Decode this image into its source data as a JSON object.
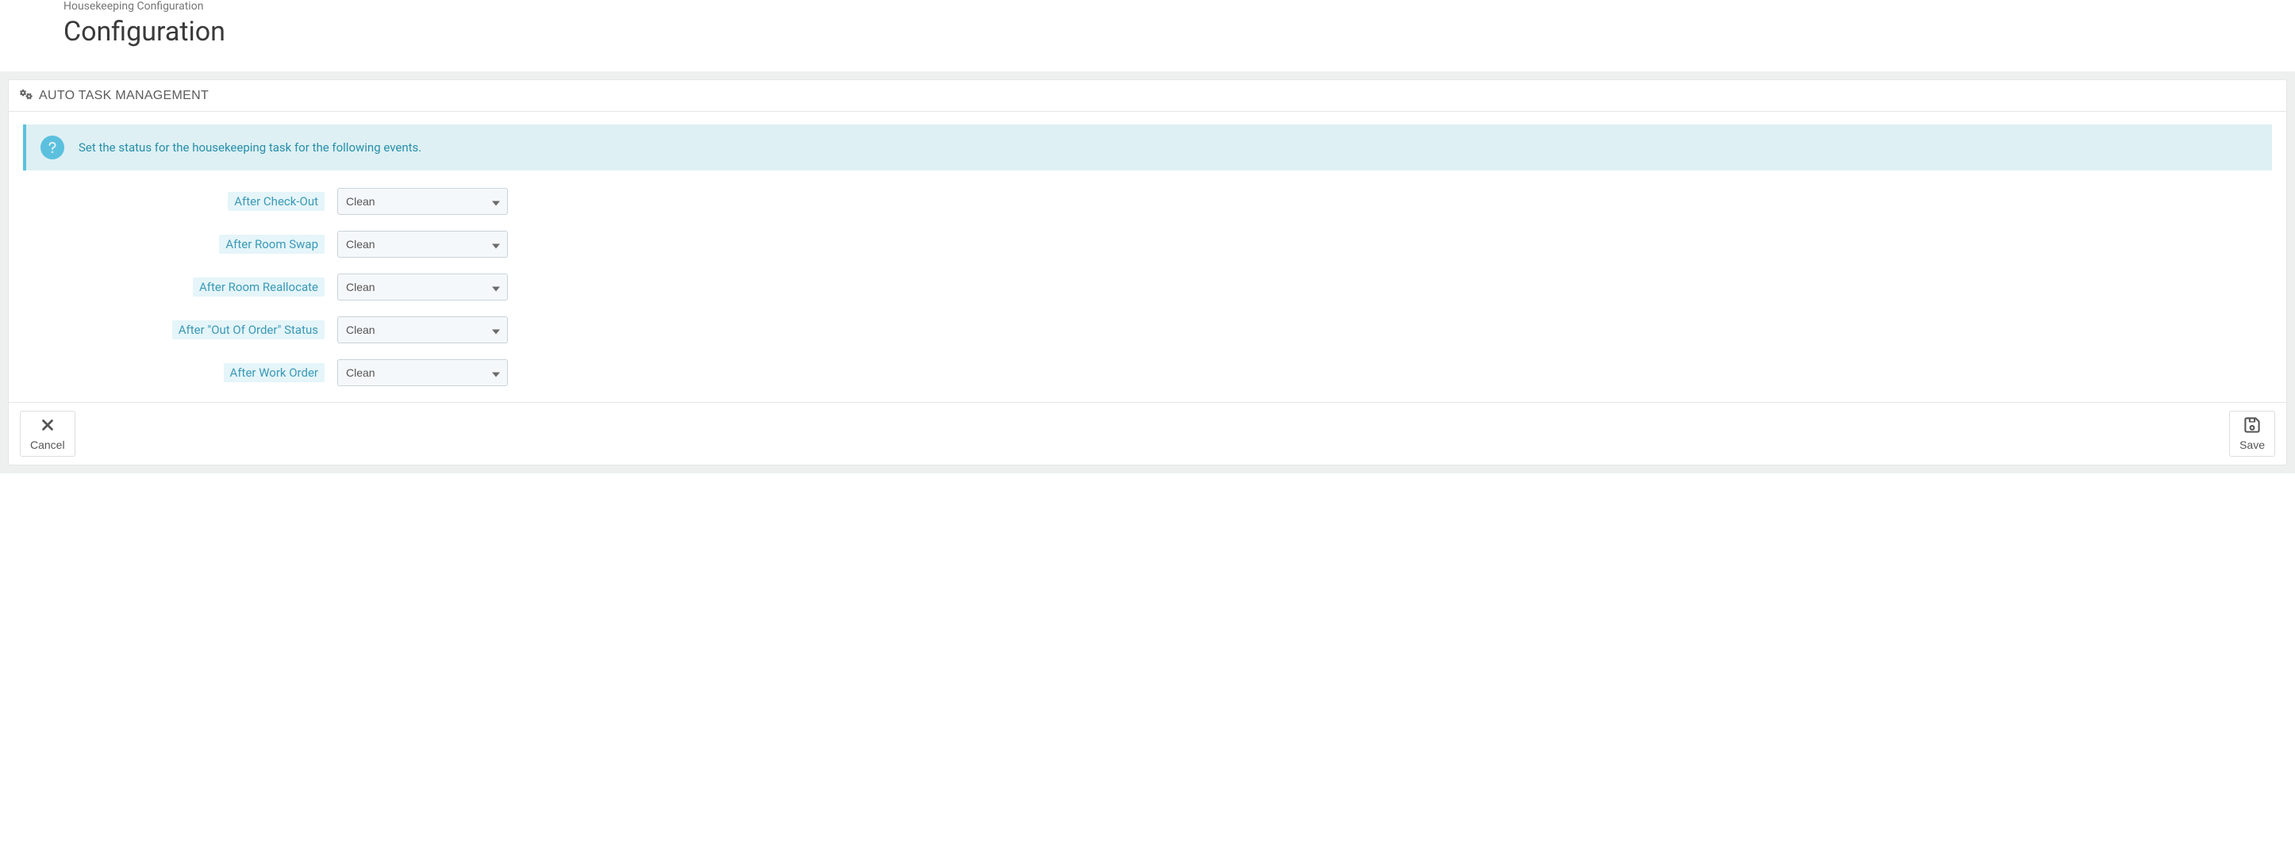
{
  "breadcrumb": "Housekeeping Configuration",
  "page_title": "Configuration",
  "panel": {
    "title": "AUTO TASK MANAGEMENT",
    "info_text": "Set the status for the housekeeping task for the following events."
  },
  "fields": {
    "after_checkout": {
      "label": "After Check-Out",
      "value": "Clean"
    },
    "after_room_swap": {
      "label": "After Room Swap",
      "value": "Clean"
    },
    "after_room_reallocate": {
      "label": "After Room Reallocate",
      "value": "Clean"
    },
    "after_out_of_order": {
      "label": "After \"Out Of Order\" Status",
      "value": "Clean"
    },
    "after_work_order": {
      "label": "After Work Order",
      "value": "Clean"
    }
  },
  "select_options": [
    "Clean"
  ],
  "buttons": {
    "cancel": "Cancel",
    "save": "Save"
  }
}
